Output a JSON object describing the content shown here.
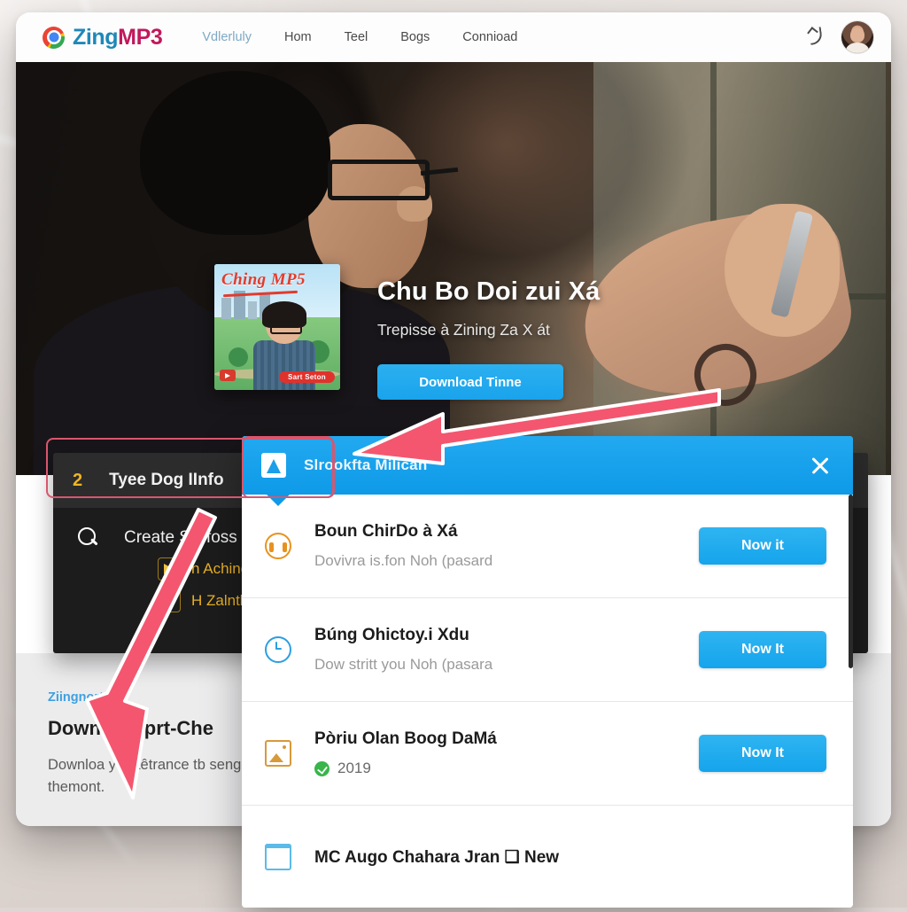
{
  "nav": {
    "brand_zing": "Zing",
    "brand_mp3": "MP3",
    "links": [
      {
        "label": "Vdlerluly",
        "active": true
      },
      {
        "label": "Hom",
        "active": false
      },
      {
        "label": "Teel",
        "active": false
      },
      {
        "label": "Bogs",
        "active": false
      },
      {
        "label": "Connioad",
        "active": false
      }
    ],
    "hook_icon": "hook-icon",
    "avatar": "user-avatar"
  },
  "hero": {
    "album": {
      "title": "Ching MP5",
      "badge_red": "Sart Seton"
    },
    "title": "Chu Bo Doi zui Xá",
    "subtitle": "Trepisse à Zining Za X át",
    "download_button": "Download Tinne"
  },
  "dark_panel": {
    "number": "2",
    "label": "Tyee Dog IInfo",
    "search_icon": "search-icon",
    "search_text": "Create Sill foss",
    "tags": [
      {
        "label": "n Aching -"
      },
      {
        "label": "H Zalntlon"
      }
    ]
  },
  "lower": {
    "kicker": "Ziingnort",
    "title": "Down W      Dprt-Che",
    "body": "Downloa         y a aêtrance tb senge se   he at themont."
  },
  "dialog": {
    "icon": "play-tile-icon",
    "title": "Slrookfta Milican",
    "close_icon": "close-icon",
    "rows": [
      {
        "icon": "headphone-icon",
        "title": "Boun ChirDo à Xá",
        "subtitle": "Dovivra is.fon Noh (pasard",
        "button": "Now it",
        "has_button": true,
        "badge": null
      },
      {
        "icon": "clock-icon",
        "title": "Búng Ohictoy.i Xdu",
        "subtitle": "Dow stritt you Noh (pasara",
        "button": "Now It",
        "has_button": true,
        "badge": null
      },
      {
        "icon": "image-icon",
        "title": "Pòriu Olan Boog DaMá",
        "subtitle": "2019",
        "button": "Now It",
        "has_button": true,
        "badge": "verified-green-check"
      },
      {
        "icon": "calendar-icon",
        "title": "MC Augo Chahara Jran ❑ New",
        "subtitle": null,
        "button": null,
        "has_button": false,
        "badge": null
      }
    ]
  },
  "annotations": {
    "highlight_color": "#d9566e",
    "arrow_color": "#f4566f",
    "arrow_right_to_left": "points-at-dialog-header",
    "arrow_down": "points-at-lower-content"
  }
}
